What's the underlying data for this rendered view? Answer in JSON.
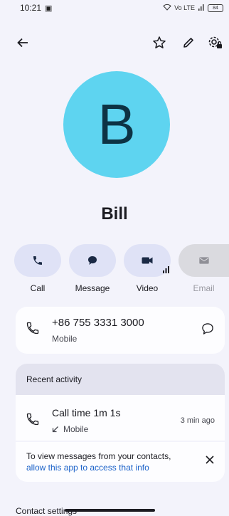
{
  "status": {
    "time": "10:21",
    "network": "Vo LTE",
    "battery": "84"
  },
  "toolbar": {
    "back_icon": "arrow-back-icon",
    "favorite_icon": "star-outline-icon",
    "edit_icon": "pencil-icon",
    "settings_icon": "gear-lock-icon"
  },
  "contact": {
    "initial": "B",
    "name": "Bill",
    "avatar_color": "#5ed4f0"
  },
  "actions": [
    {
      "label": "Call",
      "icon": "phone-icon",
      "enabled": true
    },
    {
      "label": "Message",
      "icon": "chat-bubble-icon",
      "enabled": true
    },
    {
      "label": "Video",
      "icon": "video-camera-icon",
      "enabled": true
    },
    {
      "label": "Email",
      "icon": "mail-icon",
      "enabled": false
    }
  ],
  "phone": {
    "number": "+86 755 3331 3000",
    "type": "Mobile"
  },
  "recent": {
    "title": "Recent activity",
    "call": {
      "title": "Call time 1m 1s",
      "direction_icon": "outgoing-arrow-icon",
      "type": "Mobile",
      "time_ago": "3 min ago"
    },
    "info": {
      "text": "To view messages from your contacts,",
      "link": "allow this app to access that info"
    }
  },
  "settings": {
    "label": "Contact settings"
  },
  "colors": {
    "background": "#f3f3fb",
    "action_pill": "#dfe2f6",
    "link": "#1a61c8"
  }
}
